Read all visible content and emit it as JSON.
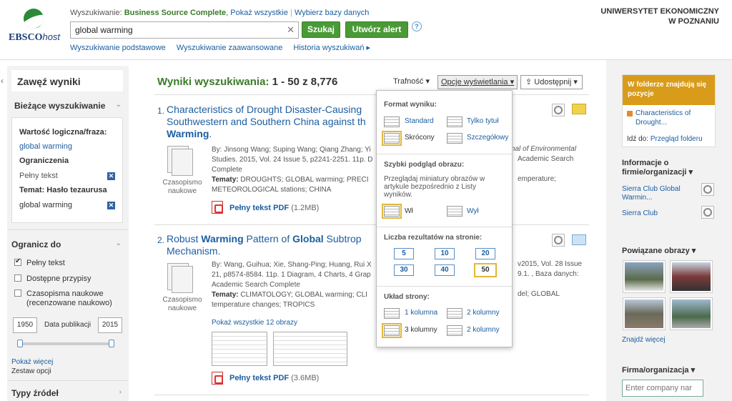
{
  "header": {
    "db_prefix": "Wyszukiwanie: ",
    "db_name": "Business Source Complete",
    "db_sep": ", ",
    "show_all": "Pokaż wszystkie",
    "choose_db": "Wybierz bazy danych",
    "search_value": "global warming",
    "search_btn": "Szukaj",
    "alert_btn": "Utwórz alert",
    "help": "?",
    "links": [
      "Wyszukiwanie podstawowe",
      "Wyszukiwanie zaawansowane",
      "Historia wyszukiwań ▸"
    ],
    "institution_line1": "UNIWERSYTET EKONOMICZNY",
    "institution_line2": "W POZNANIU",
    "logo_main": "EBSCO",
    "logo_host": "host"
  },
  "left": {
    "refine_title": "Zawęź wyniki",
    "current_title": "Bieżące wyszukiwanie",
    "bool_label": "Wartość logiczna/fraza:",
    "bool_value": "global warming",
    "limiters_label": "Ograniczenia",
    "limiter_value": "Pełny tekst",
    "subject_label": "Temat: Hasło tezaurusa",
    "subject_value": "global warming",
    "limit_title": "Ogranicz do",
    "options": [
      {
        "label": "Pełny tekst",
        "checked": true
      },
      {
        "label": "Dostępne przypisy",
        "checked": false
      },
      {
        "label": "Czasopisma naukowe",
        "checked": false
      }
    ],
    "option3_line2": "(recenzowane naukowo)",
    "year_from": "1950",
    "year_to": "2015",
    "date_label": "Data publikacji",
    "show_more": "Pokaż więcej",
    "set_options": "Zestaw opcji",
    "source_types": "Typy źródeł"
  },
  "main": {
    "results_label": "Wyniki wyszukiwania: ",
    "results_range": "1 - 50 z 8,776",
    "relevance": "Trafność ▾",
    "page_options": "Opcje wyświetlania ▾",
    "share": "Udostępnij ▾",
    "r1": {
      "num": "1.",
      "title_a": "Characteristics of Drought Disaster-Causing",
      "title_b": "Southwestern and Southern China against th",
      "title_c": "Warming",
      "title_end": ".",
      "authors": "By: Jinsong Wang; Suping Wang; Qiang Zhang; Yi",
      "journal": "urnal of Environmental",
      "studies": "Studies. 2015, Vol. 24 Issue 5, p2241-2251. 11p. D",
      "db_tail": "Academic Search",
      "complete": "Complete",
      "subjects_label": "Tematy: ",
      "subjects": "DROUGHTS; GLOBAL warming; PRECI",
      "subjects_tail": "emperature;",
      "subjects2": "METEOROLOGICAL stations; CHINA",
      "type": "Czasopismo naukowe",
      "pdf": "Pełny tekst PDF",
      "pdf_size": "(1.2MB)"
    },
    "r2": {
      "num": "2.",
      "title_a": "Robust ",
      "title_b": "Warming",
      "title_c": " Pattern of ",
      "title_d": "Global",
      "title_e": " Subtrop",
      "title_f": "Mechanism.",
      "authors": "By: Wang, Guihua; Xie, Shang-Ping; Huang, Rui X",
      "authors_tail": "v2015, Vol. 28 Issue",
      "line2": "21, p8574-8584. 11p. 1 Diagram, 4 Charts, 4 Grap",
      "line2_tail": "9.1. , Baza danych:",
      "line3": "Academic Search Complete",
      "subjects_label": "Tematy: ",
      "subjects": "CLIMATOLOGY; GLOBAL warming; CLI",
      "subjects_tail": "del; GLOBAL",
      "subjects2": "temperature changes; TROPICS",
      "type": "Czasopismo naukowe",
      "show_images": "Pokaż wszystkie 12 obrazy",
      "pdf": "Pełny tekst PDF",
      "pdf_size": "(3.6MB)"
    }
  },
  "dropdown": {
    "format_title": "Format wyniku:",
    "standard": "Standard",
    "title_only": "Tylko tytuł",
    "brief": "Skrócony",
    "detailed": "Szczegółowy",
    "preview_title": "Szybki podgląd obrazu:",
    "preview_desc": "Przeglądaj miniatury obrazów w artykule bezpośrednio z Listy wyników.",
    "on": "Wł",
    "off": "Wył",
    "per_page_title": "Liczba rezultatów na stronie:",
    "counts": [
      "5",
      "10",
      "20",
      "30",
      "40",
      "50"
    ],
    "selected_count": "50",
    "layout_title": "Układ strony:",
    "layout1": "1 kolumna",
    "layout2": "2 kolumny",
    "layout3": "3 kolumny",
    "layout4": "2 kolumny"
  },
  "right": {
    "folder_header": "W folderze znajdują się pozycje",
    "folder_item": "Characteristics of Drought...",
    "goto_label": "Idź do: ",
    "goto_link": "Przegląd folderu",
    "company_info": "Informacje o firmie/organizacji ▾",
    "company1": "Sierra Club Global Warmin...",
    "company2": "Sierra Club",
    "related_images": "Powiązane obrazy ▾",
    "find_more": "Znajdź więcej",
    "firm_title": "Firma/organizacja ▾",
    "company_placeholder": "Enter company nar"
  }
}
